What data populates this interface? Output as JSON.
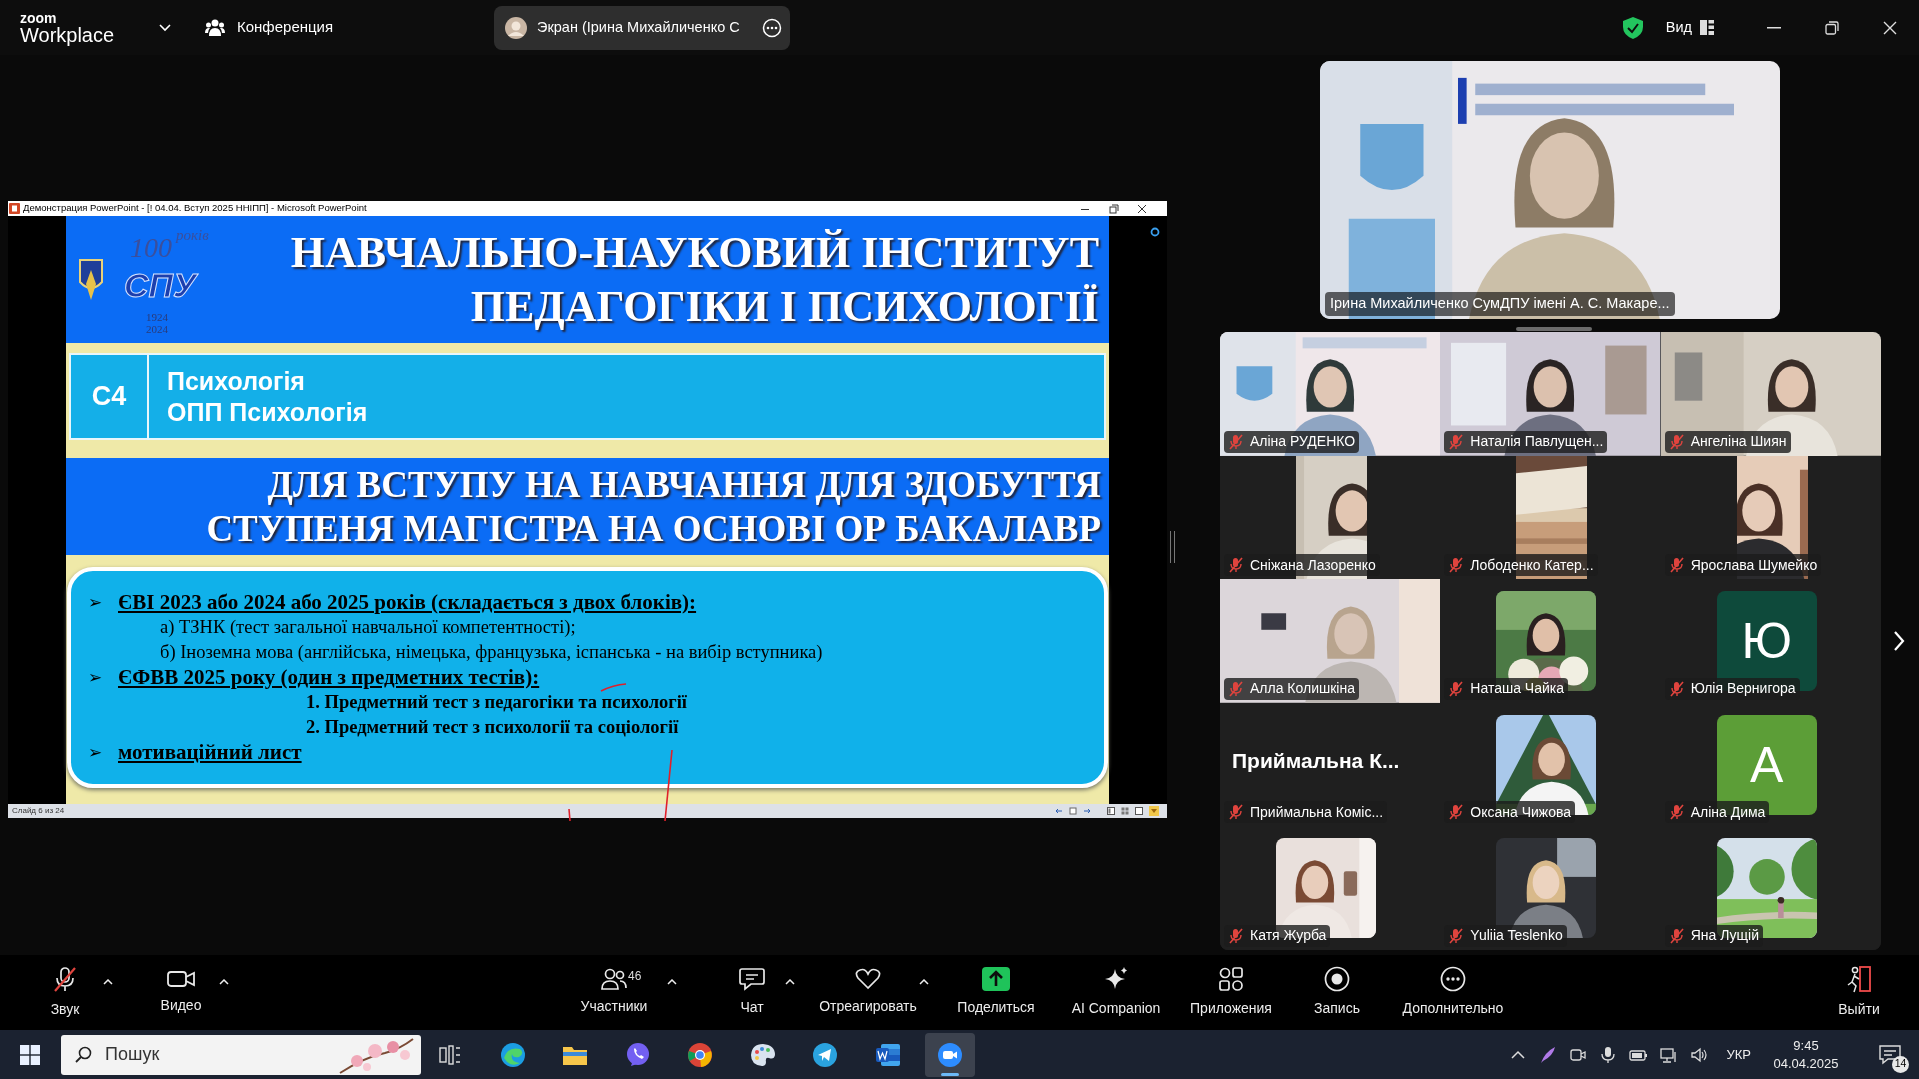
{
  "app": {
    "brand": "zoom",
    "product": "Workplace",
    "meeting": "Конференция",
    "share_pill": "Экран (Ірина Михайличенко С",
    "view": "Вид"
  },
  "presentation": {
    "window_title": "Демонстрация PowerPoint - [! 04.04. Вступ 2025 ННІПП] - Microsoft PowerPoint",
    "logo": {
      "years": "100",
      "word": "років",
      "abbr": "СПУ",
      "from": "1924",
      "to": "2024"
    },
    "title": [
      "НАВЧАЛЬНО-НАУКОВИЙ ІНСТИТУТ",
      "ПЕДАГОГІКИ І ПСИХОЛОГІЇ"
    ],
    "code": "С4",
    "program": [
      "Психологія",
      "ОПП Психологія"
    ],
    "band": [
      "ДЛЯ ВСТУПУ НА НАВЧАННЯ ДЛЯ ЗДОБУТТЯ",
      "СТУПЕНЯ МАГІСТРА НА ОСНОВІ ОР БАКАЛАВР"
    ],
    "items": [
      {
        "kind": "bullet",
        "marker": "➢",
        "text": "ЄВІ 2023 або 2024 або 2025 років (складається з двох блоків):"
      },
      {
        "kind": "sub",
        "text": "а) ТЗНК (тест загальної навчальної компетентності);"
      },
      {
        "kind": "sub",
        "text": "б) Іноземна мова (англійська, німецька, французька, іспанська - на вибір вступника)"
      },
      {
        "kind": "bullet",
        "marker": "➢",
        "text": "ЄФВВ 2025 року (один з предметних тестів):"
      },
      {
        "kind": "numbered",
        "text": "1. Предметний тест з педагогіки та психології"
      },
      {
        "kind": "numbered",
        "text": "2. Предметний тест з психології та соціології"
      },
      {
        "kind": "bullet",
        "marker": "➢",
        "text": "мотиваційний лист"
      }
    ],
    "status": "Слайд 6 из 24"
  },
  "speaker": {
    "name": "Ірина Михайличенко СумДПУ імені А. С. Макаре..."
  },
  "participants": [
    {
      "kind": "video",
      "name": "Аліна РУДЕНКО",
      "muted": true
    },
    {
      "kind": "video",
      "name": "Наталія Павлущен...",
      "muted": true
    },
    {
      "kind": "video",
      "name": "Ангеліна Шиян",
      "muted": true
    },
    {
      "kind": "narrow",
      "name": "Сніжана Лазоренко",
      "muted": true
    },
    {
      "kind": "narrow",
      "name": "Лободенко Катер...",
      "muted": true
    },
    {
      "kind": "narrow",
      "name": "Ярослава Шумейко",
      "muted": true
    },
    {
      "kind": "video",
      "name": "Алла Колишкіна",
      "muted": true
    },
    {
      "name": "Наташа Чайка",
      "muted": true
    },
    {
      "kind": "avatar",
      "name": "Юлія Вернигора",
      "muted": true,
      "letter": "Ю",
      "color": "#0e4a3b"
    },
    {
      "kind": "name_only",
      "name": "Приймальна Коміс...",
      "muted": true,
      "display": "Приймальна  К..."
    },
    {
      "name": "Оксана Чижова",
      "muted": true
    },
    {
      "kind": "avatar",
      "name": "Аліна Дима",
      "muted": true,
      "letter": "A",
      "color": "#5c9e37"
    },
    {
      "name": "Катя Журба",
      "muted": true
    },
    {
      "name": "Yuliia Teslenko",
      "muted": true
    },
    {
      "name": "Яна Лущій",
      "muted": true
    }
  ],
  "toolbar": [
    {
      "kind": "mic",
      "label": "Звук",
      "caret": true,
      "muted": true
    },
    {
      "kind": "video",
      "label": "Видео",
      "caret": true
    },
    {
      "kind": "participants",
      "label": "Участники",
      "caret": true,
      "count": "46"
    },
    {
      "kind": "chat",
      "label": "Чат",
      "caret": true
    },
    {
      "kind": "react",
      "label": "Отреагировать",
      "caret": true
    },
    {
      "kind": "share",
      "label": "Поделиться",
      "caret": false
    },
    {
      "kind": "ai",
      "label": "AI Companion",
      "caret": false
    },
    {
      "kind": "apps",
      "label": "Приложения",
      "caret": false
    },
    {
      "kind": "record",
      "label": "Запись",
      "caret": false
    },
    {
      "kind": "more",
      "label": "Дополнительно",
      "caret": false
    },
    {
      "kind": "leave",
      "label": "Выйти",
      "caret": false
    }
  ],
  "taskbar": {
    "search_placeholder": "Пошук",
    "apps": [
      {
        "kind": "taskview",
        "selected": false
      },
      {
        "kind": "edge",
        "selected": false
      },
      {
        "kind": "explorer",
        "selected": false
      },
      {
        "kind": "viber",
        "selected": false
      },
      {
        "kind": "chrome",
        "selected": false
      },
      {
        "kind": "paint",
        "selected": false
      },
      {
        "kind": "telegram",
        "selected": false
      },
      {
        "kind": "word",
        "selected": false
      },
      {
        "kind": "zoom",
        "selected": true
      }
    ],
    "language": "УКР",
    "time": "9:45",
    "date": "04.04.2025",
    "notifications": "14"
  }
}
